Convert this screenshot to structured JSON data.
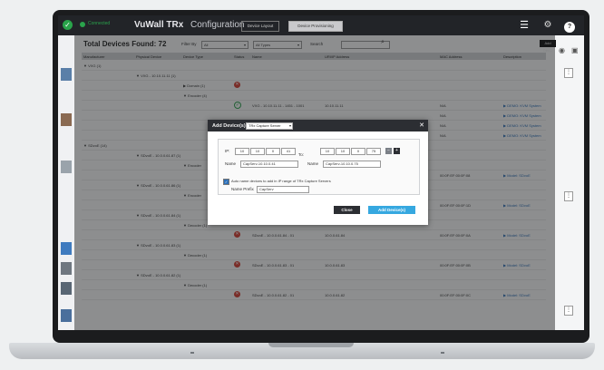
{
  "topbar": {
    "connection": "Connected",
    "app_title": "VuWall TRx",
    "section_title": "Configuration",
    "tabs": [
      {
        "label": "Device Layout",
        "active": false
      },
      {
        "label": "Device Provisioning",
        "active": true
      }
    ]
  },
  "toolbar": {
    "total_label": "Total Devices Found: 72",
    "filter_label": "Filter By",
    "filter_value": "All",
    "type_value": "All Types",
    "search_label": "Search",
    "add_label": "Add Dev..."
  },
  "table": {
    "columns": [
      "Manufacturer",
      "Physical Device",
      "Device Type",
      "Status",
      "Name",
      "URI/IP Address",
      "MAC Address",
      "Description"
    ],
    "rows": [
      {
        "kind": "group",
        "indent": 0,
        "label": "▼ VXG (1)"
      },
      {
        "kind": "group",
        "indent": 1,
        "label": "▼ VXG - 10.10.11.11 (1)"
      },
      {
        "kind": "group",
        "indent": 2,
        "label": "▶ Domain (1)",
        "status": "red"
      },
      {
        "kind": "group",
        "indent": 2,
        "label": "▼ Encoder (4)"
      },
      {
        "kind": "device",
        "status": "green",
        "name": "VXG - 10.10.11.11 - 1451 - 1001",
        "ip": "10.10.11.11",
        "mac": "N/A",
        "desc": "▶ DEMO: KVM System"
      },
      {
        "kind": "device",
        "status": "",
        "name": "",
        "ip": "",
        "mac": "N/A",
        "desc": "▶ DEMO: KVM System"
      },
      {
        "kind": "device",
        "status": "",
        "name": "",
        "ip": "",
        "mac": "N/A",
        "desc": "▶ DEMO: KVM System"
      },
      {
        "kind": "device",
        "status": "",
        "name": "",
        "ip": "",
        "mac": "N/A",
        "desc": "▶ DEMO: KVM System"
      },
      {
        "kind": "group",
        "indent": 0,
        "label": "▼ SDvoE (14)"
      },
      {
        "kind": "group",
        "indent": 1,
        "label": "▼ SDvoE - 10.0.0.61.87 (1)"
      },
      {
        "kind": "group",
        "indent": 2,
        "label": "▼ Encoder"
      },
      {
        "kind": "device",
        "status": "",
        "name": "",
        "ip": "",
        "mac": "00:0F:EF:00:0F:08",
        "desc": "▶ Model: SDvoE"
      },
      {
        "kind": "group",
        "indent": 1,
        "label": "▼ SDvoE - 10.0.0.61.86 (1)"
      },
      {
        "kind": "group",
        "indent": 2,
        "label": "▼ Encoder"
      },
      {
        "kind": "device",
        "status": "",
        "name": "",
        "ip": "",
        "mac": "00:0F:EF:00:0F:1D",
        "desc": "▶ Model: SDvoE"
      },
      {
        "kind": "group",
        "indent": 1,
        "label": "▼ SDvoE - 10.0.0.61.84 (1)"
      },
      {
        "kind": "group",
        "indent": 2,
        "label": "▼ Decoder (1)"
      },
      {
        "kind": "device",
        "status": "red",
        "name": "SDvoE - 10.0.0.61.84 - 01",
        "ip": "10.0.0.61.84",
        "mac": "00:0F:EF:00:0F:0A",
        "desc": "▶ Model: SDvoE"
      },
      {
        "kind": "group",
        "indent": 1,
        "label": "▼ SDvoE - 10.0.0.61.83 (1)"
      },
      {
        "kind": "group",
        "indent": 2,
        "label": "▼ Decoder (1)"
      },
      {
        "kind": "device",
        "status": "red",
        "name": "SDvoE - 10.0.0.61.83 - 01",
        "ip": "10.0.0.61.83",
        "mac": "00:0F:EF:00:0F:0B",
        "desc": "▶ Model: SDvoE"
      },
      {
        "kind": "group",
        "indent": 1,
        "label": "▼ SDvoE - 10.0.0.61.82 (1)"
      },
      {
        "kind": "group",
        "indent": 2,
        "label": "▼ Decoder (1)"
      },
      {
        "kind": "device",
        "status": "red",
        "name": "SDvoE - 10.0.0.61.82 - 01",
        "ip": "10.0.0.61.82",
        "mac": "00:0F:EF:00:0F:0C",
        "desc": "▶ Model: SDvoE"
      }
    ]
  },
  "dialog": {
    "title": "Add Device(s):",
    "device_type": "TRx Capture Server",
    "ip_from_label": "IP:",
    "ip_to_label": "To:",
    "ip_from": [
      "10",
      "10",
      "0",
      "41"
    ],
    "ip_to": [
      "10",
      "10",
      "0",
      "75"
    ],
    "name_label": "Name",
    "name_from": "CapServ-10.10.0.41",
    "name_to": "CapServ-10.10.0.75",
    "auto_name_label": "Auto name devices to add in IP range of TRx Capture Servers",
    "prefix_label": "Name Prefix",
    "prefix_value": "CapServ",
    "minus": "−",
    "plus": "+",
    "close_label": "Close",
    "add_label": "Add Device(s)"
  },
  "icons": {
    "hamburger": "☰",
    "gear": "⚙",
    "help": "?",
    "logo": "✓",
    "close": "✕",
    "search": "⌕",
    "check": "✓",
    "error": "✕",
    "ok": "✓"
  },
  "colors": {
    "accent": "#36a8e0",
    "ok": "#2aa34c",
    "error": "#d83a2e",
    "header": "#2c2e33"
  }
}
